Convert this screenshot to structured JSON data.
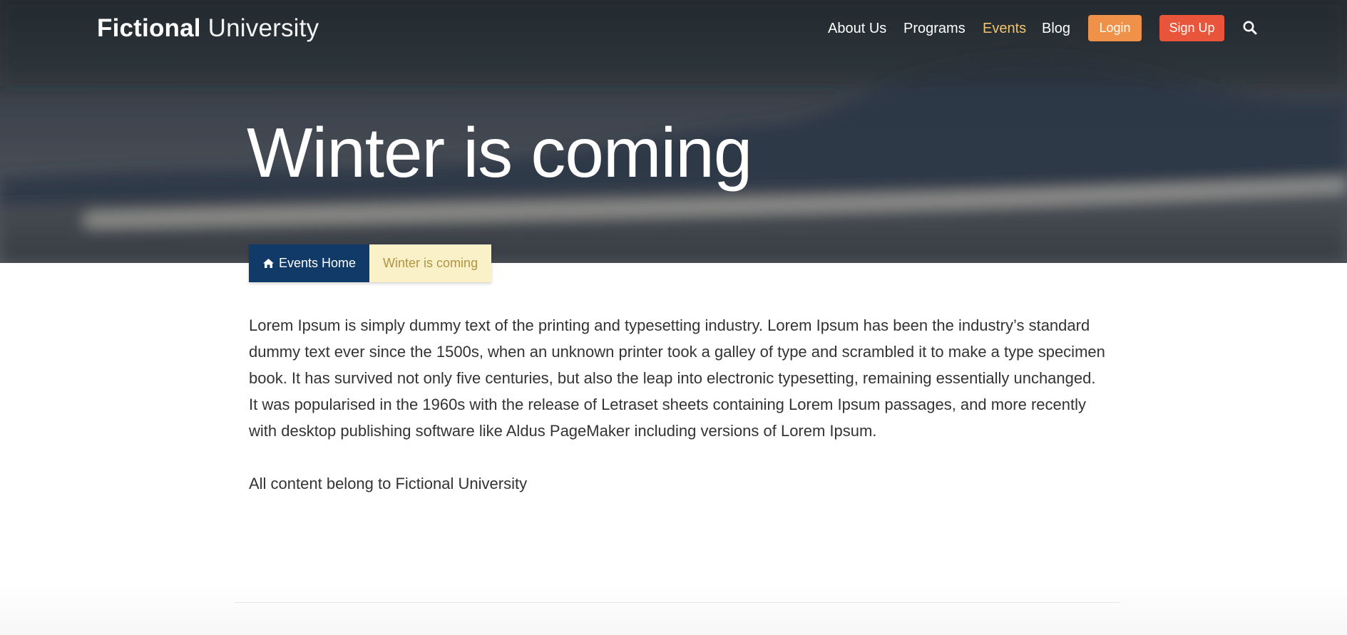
{
  "header": {
    "logo_strong": "Fictional",
    "logo_light": " University",
    "nav": {
      "about": "About Us",
      "programs": "Programs",
      "events": "Events",
      "blog": "Blog"
    },
    "login_label": "Login",
    "signup_label": "Sign Up"
  },
  "hero": {
    "title": "Winter is coming"
  },
  "breadcrumb": {
    "home_label": "Events Home",
    "current_label": "Winter is coming"
  },
  "content": {
    "paragraph": "Lorem Ipsum is simply dummy text of the printing and typesetting industry. Lorem Ipsum has been the industry’s standard dummy text ever since the 1500s, when an unknown printer took a galley of type and scrambled it to make a type specimen book. It has survived not only five centuries, but also the leap into electronic typesetting, remaining essentially unchanged. It was popularised in the 1960s with the release of Letraset sheets containing Lorem Ipsum passages, and more recently with desktop publishing software like Aldus PageMaker including versions of Lorem Ipsum.",
    "footer_note": "All content belong to Fictional University"
  },
  "colors": {
    "brand_blue": "#113a68",
    "login_orange": "#f0914a",
    "signup_red": "#e9553b",
    "nav_active": "#f2c46a",
    "crumb_current_bg": "#faf1c8",
    "crumb_current_text": "#b09444"
  },
  "icons": {
    "search": "search-icon",
    "home": "home-icon"
  }
}
